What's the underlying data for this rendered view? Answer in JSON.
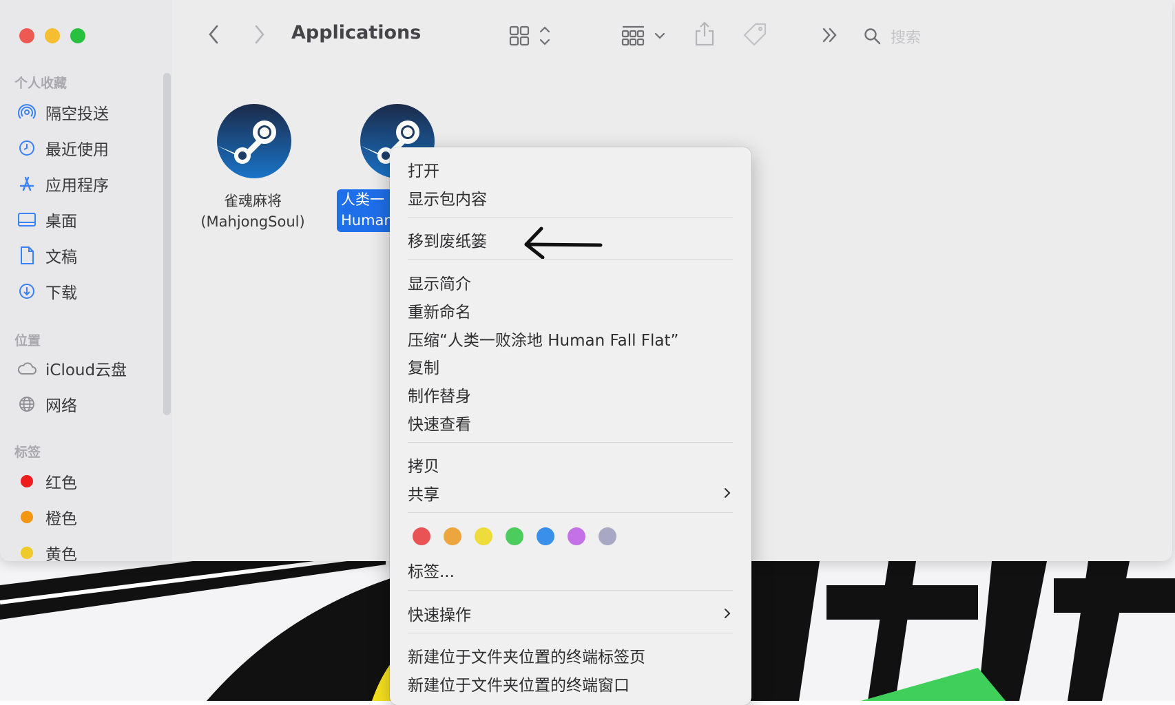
{
  "window": {
    "title": "Applications",
    "search_placeholder": "搜索"
  },
  "sidebar": {
    "favorites_title": "个人收藏",
    "favorites": [
      {
        "label": "隔空投送",
        "icon": "airdrop-icon"
      },
      {
        "label": "最近使用",
        "icon": "clock-icon"
      },
      {
        "label": "应用程序",
        "icon": "applications-icon"
      },
      {
        "label": "桌面",
        "icon": "desktop-icon"
      },
      {
        "label": "文稿",
        "icon": "document-icon"
      },
      {
        "label": "下载",
        "icon": "download-icon"
      }
    ],
    "locations_title": "位置",
    "locations": [
      {
        "label": "iCloud云盘",
        "icon": "cloud-icon"
      },
      {
        "label": "网络",
        "icon": "globe-icon"
      }
    ],
    "tags_title": "标签",
    "tags": [
      {
        "label": "红色",
        "color": "#ee1c1c"
      },
      {
        "label": "橙色",
        "color": "#f39612"
      },
      {
        "label": "黄色",
        "color": "#f0c92a"
      }
    ]
  },
  "files": [
    {
      "name_line1": "雀魂麻将",
      "name_line2": "(MahjongSoul)",
      "icon": "steam-icon"
    },
    {
      "name_line1": "人类一",
      "name_line2": "Human",
      "icon": "steam-icon",
      "selected": true
    }
  ],
  "context_menu": {
    "items": {
      "open": "打开",
      "show_package": "显示包内容",
      "move_to_trash": "移到废纸篓",
      "get_info": "显示简介",
      "rename": "重新命名",
      "compress": "压缩“人类一败涂地  Human Fall Flat”",
      "duplicate": "复制",
      "make_alias": "制作替身",
      "quick_look": "快速查看",
      "copy": "拷贝",
      "share": "共享",
      "tags": "标签...",
      "quick_actions": "快速操作",
      "new_terminal_tab": "新建位于文件夹位置的终端标签页",
      "new_terminal_window": "新建位于文件夹位置的终端窗口"
    },
    "tag_colors": [
      "#e95353",
      "#eca63d",
      "#eedc3c",
      "#4ccc5c",
      "#3a8fea",
      "#c470e6",
      "#a8a8c4"
    ]
  },
  "annotation": {
    "arrow": "left-arrow-annotation"
  },
  "colors": {
    "accent": "#1f6feb",
    "close": "#ee5a52",
    "minimize": "#f5be31",
    "zoom": "#27c13f"
  }
}
